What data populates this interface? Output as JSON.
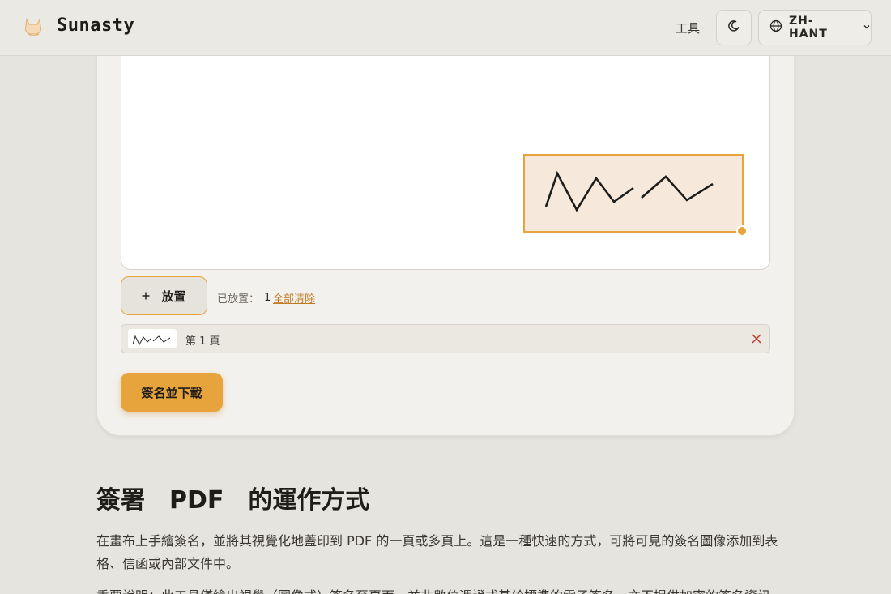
{
  "header": {
    "brand": "Sunasty",
    "nav_tools": "工具",
    "language": "ZH-HANT"
  },
  "signer": {
    "place_label": "放置",
    "placed_label": "已放置：",
    "placed_count": "1",
    "clear_all": "全部清除",
    "placements": [
      {
        "page": "第 1 頁"
      }
    ],
    "sign_download": "簽名並下載"
  },
  "article": {
    "title": "簽署　PDF　的運作方式",
    "para1": "在畫布上手繪簽名，並將其視覺化地蓋印到 PDF 的一頁或多頁上。這是一種快速的方式，可將可見的簽名圖像添加到表格、信函或內部文件中。",
    "para2": "重要說明：此工具僅繪出視覺（圖像式）簽名至頁面，並非數位憑證或基於標準的電子簽名，亦不提供加密的簽名資訊。"
  },
  "colors": {
    "accent": "#e8a43c",
    "background": "#e6e4df",
    "link": "#c07a24",
    "remove": "#c0392b"
  },
  "icons": {
    "logo": "cat-logo-icon",
    "theme": "moon-icon",
    "language": "globe-icon",
    "dropdown": "chevron-down-icon",
    "place": "plus-icon",
    "remove": "close-icon"
  }
}
